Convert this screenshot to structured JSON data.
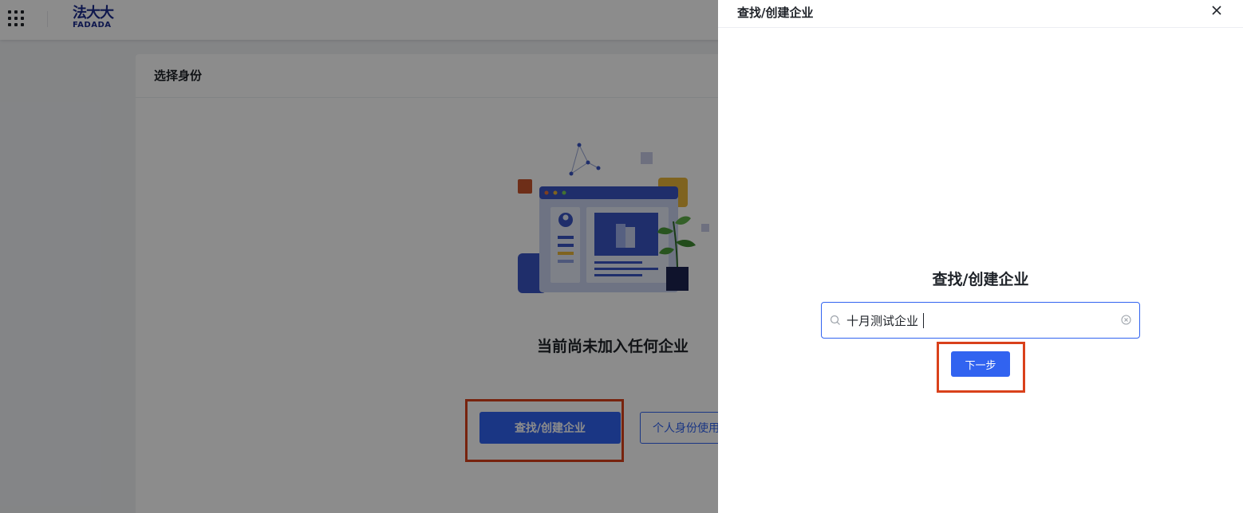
{
  "app": {
    "logo_cn": "法大大",
    "logo_en": "FADADA"
  },
  "page": {
    "card_title": "选择身份",
    "empty_message": "当前尚未加入任何企业",
    "find_create_button": "查找/创建企业",
    "personal_button": "个人身份使用"
  },
  "drawer": {
    "title": "查找/创建企业",
    "heading": "查找/创建企业",
    "search_value": "十月测试企业",
    "search_placeholder": "",
    "next_button": "下一步"
  },
  "icons": {
    "apps": "apps-grid-icon",
    "close": "close-icon",
    "search": "search-icon",
    "clear": "clear-circle-icon"
  },
  "colors": {
    "primary": "#3163f0",
    "highlight": "#d9411b",
    "brand": "#1a2a8c"
  }
}
